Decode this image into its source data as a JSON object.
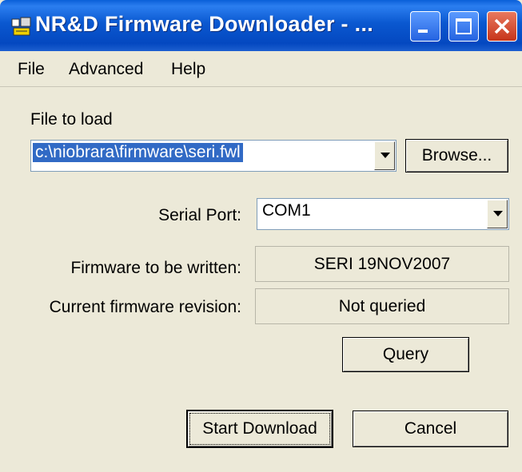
{
  "window": {
    "title": "NR&D Firmware Downloader - ..."
  },
  "menu": {
    "file": "File",
    "advanced": "Advanced",
    "help": "Help"
  },
  "file_to_load": {
    "label": "File to load",
    "value": "c:\\niobrara\\firmware\\seri.fwl",
    "browse_label": "Browse..."
  },
  "serial_port": {
    "label": "Serial Port:",
    "value": "COM1"
  },
  "firmware": {
    "label": "Firmware to be written:",
    "value": "SERI 19NOV2007"
  },
  "current_revision": {
    "label": "Current firmware revision:",
    "value": "Not queried"
  },
  "buttons": {
    "query": "Query",
    "start_download": "Start Download",
    "cancel": "Cancel"
  },
  "colors": {
    "titlebar": "#0a58d0",
    "selection": "#316ac5",
    "close": "#c6341a",
    "face": "#ece9d8"
  }
}
